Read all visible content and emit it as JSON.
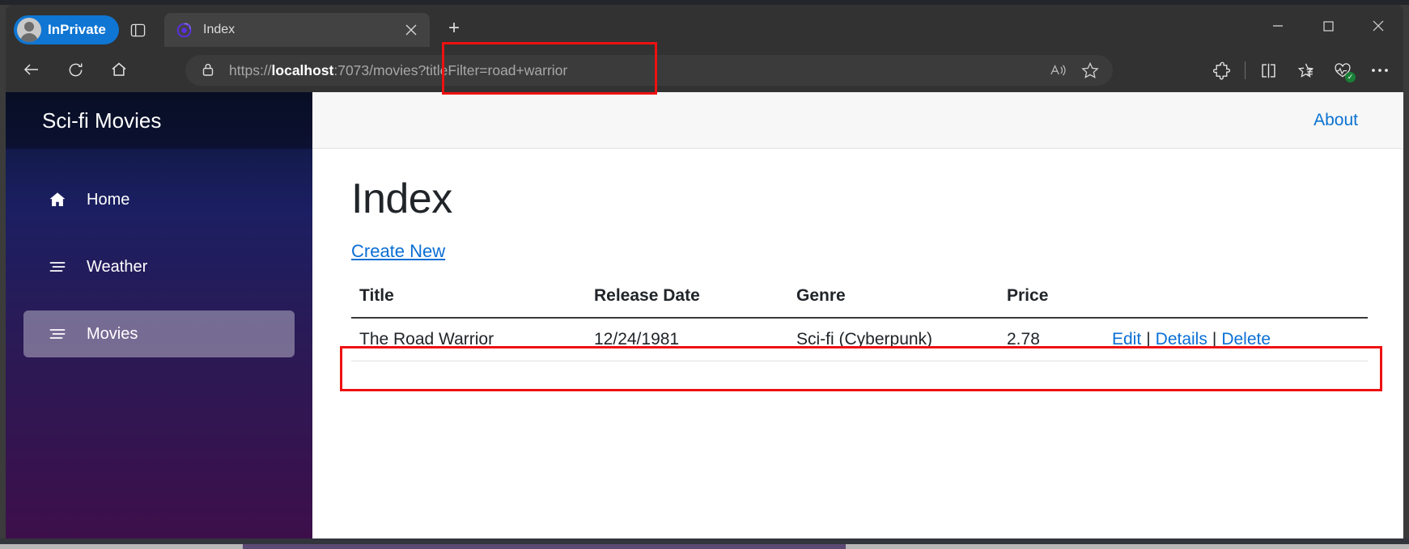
{
  "browser": {
    "profile_pill": "InPrivate",
    "tab_search_icon": "tab-search-icon",
    "tabs": [
      {
        "title": "Index",
        "favicon": "blazor-favicon",
        "close_icon": "close-icon"
      }
    ],
    "new_tab_label": "+",
    "window_controls": {
      "minimize": "minimize-icon",
      "maximize": "maximize-icon",
      "close": "close-icon"
    },
    "nav": {
      "back_icon": "back-arrow-icon",
      "refresh_icon": "refresh-icon",
      "home_icon": "home-icon"
    },
    "address_bar": {
      "lock_icon": "lock-icon",
      "url_scheme": "https://",
      "url_host": "localhost",
      "url_rest": ":7073/movies?titleFilter=road+warrior",
      "url_full": "https://localhost:7073/movies?titleFilter=road+warrior",
      "read_aloud_icon": "read-aloud-icon",
      "favorite_icon": "star-outline-icon"
    },
    "toolbar_right": [
      {
        "icon": "extensions-puzzle-icon"
      },
      {
        "icon": "split-screen-icon"
      },
      {
        "icon": "favorites-star-list-icon"
      },
      {
        "icon": "browser-essentials-heart-icon",
        "badge": "✓"
      },
      {
        "icon": "settings-ellipsis-icon"
      }
    ]
  },
  "page": {
    "sidebar": {
      "brand": "Sci-fi Movies",
      "items": [
        {
          "label": "Home",
          "icon": "house-icon",
          "active": false
        },
        {
          "label": "Weather",
          "icon": "list-lines-icon",
          "active": false
        },
        {
          "label": "Movies",
          "icon": "list-lines-icon",
          "active": true
        }
      ]
    },
    "topbar": {
      "about_label": "About"
    },
    "main": {
      "title": "Index",
      "create_new_label": "Create New",
      "table": {
        "columns": [
          "Title",
          "Release Date",
          "Genre",
          "Price",
          ""
        ],
        "rows": [
          {
            "title": "The Road Warrior",
            "release_date": "12/24/1981",
            "genre": "Sci-fi (Cyberpunk)",
            "price": "2.78",
            "actions": {
              "edit": "Edit",
              "details": "Details",
              "delete": "Delete",
              "separator": "|"
            }
          }
        ]
      }
    }
  },
  "annotations": {
    "url_query_highlight": "red-box-around-titleFilter-query",
    "result_row_highlight": "red-box-around-result-row"
  },
  "colors": {
    "accent_link": "#0a6fd4",
    "annotation": "#ee1111",
    "sidebar_top": "#0b1634",
    "sidebar_bottom": "#3d0f4a",
    "inprivate_pill": "#0f76d3"
  }
}
